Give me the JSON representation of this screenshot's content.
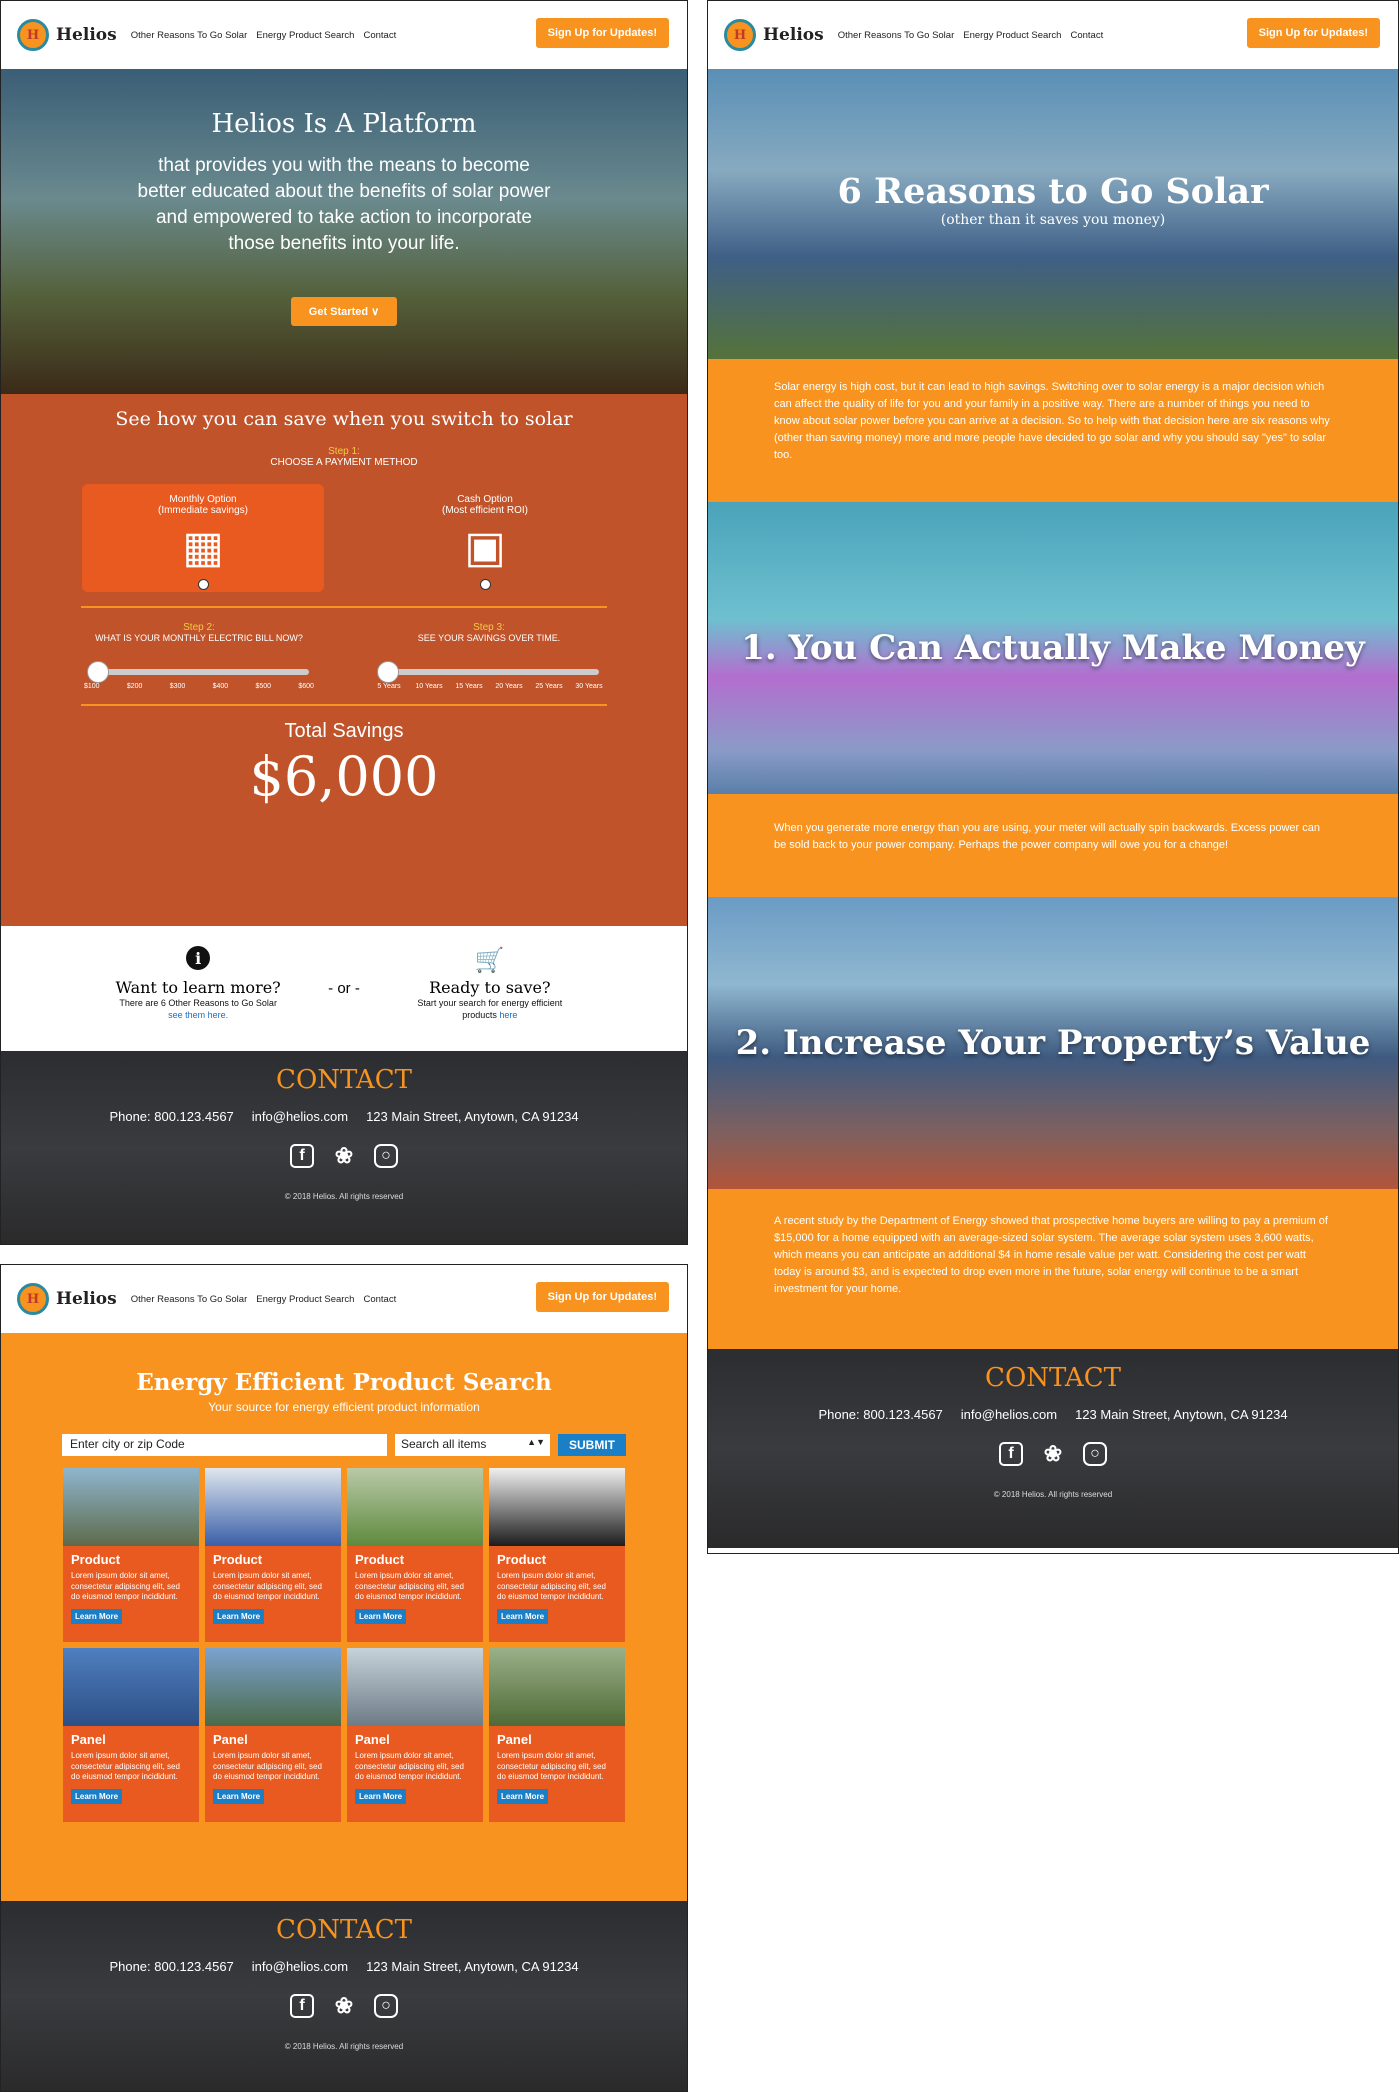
{
  "nav": {
    "brand": "Helios",
    "logo_letter": "H",
    "links": [
      "Other Reasons To Go Solar",
      "Energy Product Search",
      "Contact"
    ],
    "signup": "Sign Up for Updates!"
  },
  "home": {
    "hero_title": "Helios Is A Platform",
    "hero_text": "that provides you with the means to become better educated about the benefits of solar power and empowered to take action to incorporate those benefits into your life.",
    "get_started": "Get Started",
    "savings_title": "See how you can save when you switch to solar",
    "step1": "Step 1:",
    "step1_desc": "CHOOSE A PAYMENT METHOD",
    "option1": "Monthly Option",
    "option1_sub": "(Immediate savings)",
    "option2": "Cash Option",
    "option2_sub": "(Most efficient ROI)",
    "step2": "Step 2:",
    "step2_desc": "WHAT IS YOUR MONTHLY ELECTRIC BILL NOW?",
    "step3": "Step 3:",
    "step3_desc": "SEE YOUR SAVINGS OVER TIME.",
    "bill_ticks": [
      "$100",
      "$200",
      "$300",
      "$400",
      "$500",
      "$600"
    ],
    "year_ticks": [
      "5 Years",
      "10 Years",
      "15 Years",
      "20 Years",
      "25 Years",
      "30 Years"
    ],
    "total_label": "Total Savings",
    "total_amount": "$6,000",
    "learn_title": "Want to learn more?",
    "learn_text": "There are 6 Other Reasons to Go Solar",
    "learn_link": "see them here.",
    "or": "- or -",
    "save_title": "Ready to save?",
    "save_text": "Start your search for energy efficient products",
    "save_link": "here"
  },
  "contact": {
    "title": "CONTACT",
    "phone": "Phone: 800.123.4567",
    "email": "info@helios.com",
    "address": "123 Main Street, Anytown, CA 91234",
    "copyright": "© 2018 Helios. All rights reserved"
  },
  "reasons": {
    "title": "6 Reasons to Go Solar",
    "subtitle": "(other than it saves you money)",
    "intro": "Solar energy is high cost, but it can lead to high savings. Switching over to solar energy is a major decision which can affect the quality of life for you and your family in a positive way. There are a number of things you need to know about solar power before you can arrive at a decision. So to help with that decision here are six reasons why (other than saving money) more and more people have decided to go solar and why you should say \"yes\" to solar too.",
    "r1_title": "1. You Can Actually Make Money",
    "r1_text": "When you generate more energy than you are using, your meter will actually spin backwards. Excess power can be sold back to your power company. Perhaps the power company will owe you for a change!",
    "r2_title": "2. Increase Your Property’s Value",
    "r2_text": "A recent study by the Department of Energy showed that prospective home buyers are willing to pay a premium of $15,000 for a home equipped with an average-sized solar system. The average solar system uses 3,600 watts, which means you can anticipate an additional $4 in home resale value per watt. Considering the cost per watt today is around $3, and is expected to drop even more in the future, solar energy will continue to be a smart investment for your home."
  },
  "search": {
    "title": "Energy Efficient Product Search",
    "subtitle": "Your source for energy efficient product information",
    "input_value": "Enter city or zip Code",
    "select_value": "Search all items",
    "submit": "SUBMIT",
    "card_text": "Lorem ipsum dolor sit amet, consectetur adipiscing elit, sed do eiusmod tempor incididunt.",
    "learn_more": "Learn More",
    "row1_title": "Product",
    "row2_title": "Panel"
  },
  "colors": {
    "orange": "#f7931e",
    "rust": "#c0532a",
    "accent": "#e85a20",
    "blue": "#1a7fc7"
  }
}
